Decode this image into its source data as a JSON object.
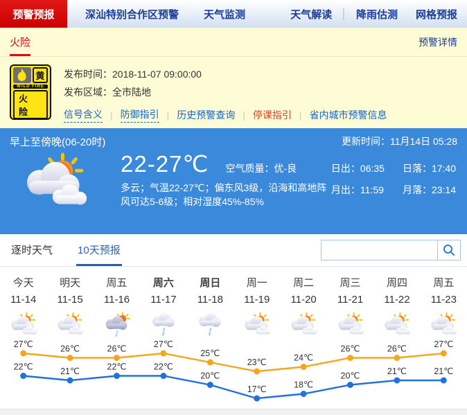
{
  "nav": {
    "active_tab": "预警预报",
    "tabs": [
      "深汕特别合作区预警",
      "天气监测"
    ],
    "links": [
      "天气解读",
      "降雨估测",
      "网格预报"
    ]
  },
  "warning_bar": {
    "tab": "火险",
    "detail_link": "预警详情"
  },
  "warning": {
    "badge": {
      "level_char": "黄",
      "type_en": "WILD FIRE",
      "type_cn": "火 险",
      "icon": "flame-icon"
    },
    "publish_time_label": "发布时间：",
    "publish_time": "2018-11-07 09:00:00",
    "publish_area_label": "发布区域：",
    "publish_area": "全市陆地",
    "links": [
      {
        "label": "信号含义",
        "style": "dashed"
      },
      {
        "label": "防御指引",
        "style": "dashed"
      },
      {
        "label": "历史预警查询",
        "style": "plain"
      },
      {
        "label": "停课指引",
        "style": "red"
      },
      {
        "label": "省内城市预警信息",
        "style": "plain"
      }
    ]
  },
  "current": {
    "period": "早上至傍晚(06-20时)",
    "update_label": "更新时间：",
    "update_time": "11月14日 05:28",
    "weather_icon": "partly-cloudy",
    "temp_range": "22-27℃",
    "air_label": "空气质量：",
    "air_value": "优-良",
    "description": "多云；气温22-27℃；偏东风3级，沿海和高地阵风可达5-6级；相对湿度45%-85%",
    "astro": [
      {
        "label": "日出：",
        "value": "06:35"
      },
      {
        "label": "日落：",
        "value": "17:40"
      },
      {
        "label": "月出：",
        "value": "11:59"
      },
      {
        "label": "月落：",
        "value": "23:14"
      }
    ]
  },
  "forecast": {
    "tabs": [
      {
        "label": "逐时天气",
        "active": false
      },
      {
        "label": "10天预报",
        "active": true
      }
    ],
    "search": {
      "value": "",
      "placeholder": "",
      "button_icon": "magnifier"
    },
    "days": [
      {
        "day": "今天",
        "date": "11-14",
        "icon": "partly-cloudy",
        "bold": false
      },
      {
        "day": "明天",
        "date": "11-15",
        "icon": "partly-cloudy",
        "bold": false
      },
      {
        "day": "周五",
        "date": "11-16",
        "icon": "shower-sun",
        "bold": false
      },
      {
        "day": "周六",
        "date": "11-17",
        "icon": "rain",
        "bold": true
      },
      {
        "day": "周日",
        "date": "11-18",
        "icon": "rain",
        "bold": true
      },
      {
        "day": "周一",
        "date": "11-19",
        "icon": "partly-cloudy",
        "bold": false
      },
      {
        "day": "周二",
        "date": "11-20",
        "icon": "partly-cloudy",
        "bold": false
      },
      {
        "day": "周三",
        "date": "11-21",
        "icon": "partly-cloudy",
        "bold": false
      },
      {
        "day": "周四",
        "date": "11-22",
        "icon": "partly-cloudy",
        "bold": false
      },
      {
        "day": "周五",
        "date": "11-23",
        "icon": "partly-cloudy",
        "bold": false
      }
    ]
  },
  "chart_data": {
    "type": "line",
    "categories": [
      "11-14",
      "11-15",
      "11-16",
      "11-17",
      "11-18",
      "11-19",
      "11-20",
      "11-21",
      "11-22",
      "11-23"
    ],
    "series": [
      {
        "name": "high",
        "color": "#f8a41d",
        "values": [
          27,
          26,
          26,
          27,
          25,
          23,
          24,
          26,
          26,
          27
        ]
      },
      {
        "name": "low",
        "color": "#2070dd",
        "values": [
          22,
          21,
          22,
          22,
          20,
          17,
          18,
          20,
          21,
          21
        ]
      }
    ],
    "unit": "℃",
    "ylim": [
      15,
      29
    ],
    "grid": false,
    "point_labels": true,
    "legend": "none"
  },
  "colors": {
    "nav_active_bg": "#d8000f",
    "nav_link": "#1c3c96",
    "warning_bg": "#fdfcd5",
    "warning_tab_red": "#e60012",
    "panel_blue": "#3b89da",
    "link_blue": "#1464c8",
    "link_red": "#e8391d",
    "tab_active_blue": "#2565c6",
    "high_line": "#f8a41d",
    "low_line": "#2070dd"
  }
}
